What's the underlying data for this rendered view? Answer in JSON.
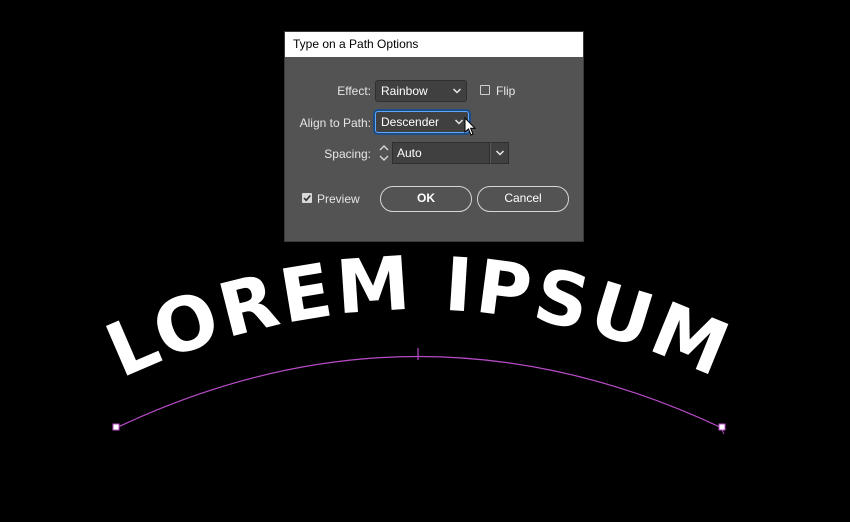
{
  "dialog": {
    "title": "Type on a Path Options",
    "effect": {
      "label": "Effect:",
      "value": "Rainbow"
    },
    "flip": {
      "label": "Flip",
      "checked": false
    },
    "align": {
      "label": "Align to Path:",
      "value": "Descender"
    },
    "spacing": {
      "label": "Spacing:",
      "value": "Auto"
    },
    "preview": {
      "label": "Preview",
      "checked": true
    },
    "ok_label": "OK",
    "cancel_label": "Cancel"
  },
  "artwork": {
    "text": "LOREM IPSUM",
    "path_color": "#b74bc6",
    "text_color": "#ffffff"
  }
}
